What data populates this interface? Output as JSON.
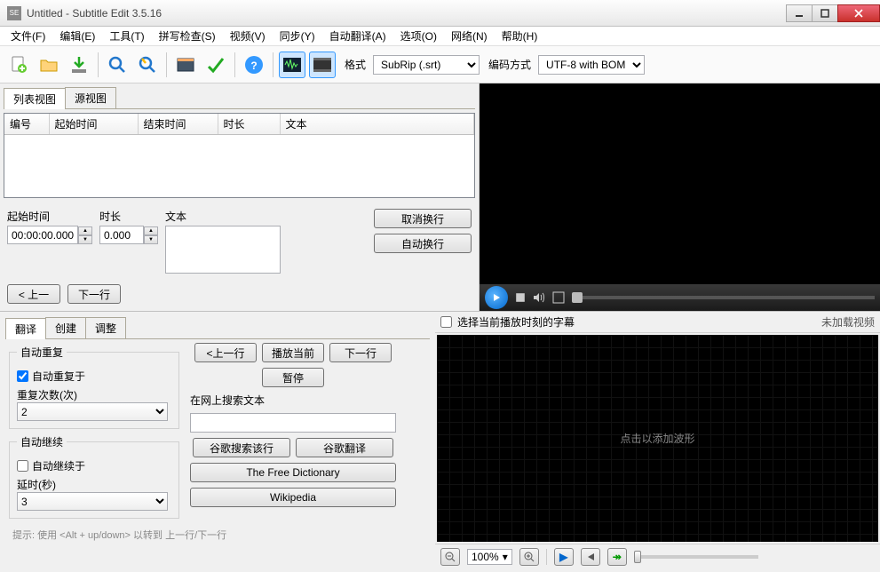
{
  "title": "Untitled - Subtitle Edit 3.5.16",
  "menu": {
    "file": "文件(F)",
    "edit": "编辑(E)",
    "tools": "工具(T)",
    "spell": "拼写检查(S)",
    "video": "视频(V)",
    "sync": "同步(Y)",
    "autotrans": "自动翻译(A)",
    "options": "选项(O)",
    "network": "网络(N)",
    "help": "帮助(H)"
  },
  "toolbar": {
    "format_label": "格式",
    "format_value": "SubRip (.srt)",
    "encoding_label": "编码方式",
    "encoding_value": "UTF-8 with BOM"
  },
  "listArea": {
    "tab_list": "列表视图",
    "tab_source": "源视图",
    "col_no": "编号",
    "col_start": "起始时间",
    "col_end": "结束时间",
    "col_dur": "时长",
    "col_text": "文本"
  },
  "edit": {
    "start_label": "起始时间",
    "start_value": "00:00:00.000",
    "dur_label": "时长",
    "dur_value": "0.000",
    "text_label": "文本",
    "unbreak": "取消换行",
    "autobreak": "自动换行",
    "prev": "< 上一",
    "next": "下一行"
  },
  "bottom": {
    "tab_translate": "翻译",
    "tab_create": "创建",
    "tab_adjust": "调整",
    "auto_repeat_group": "自动重复",
    "auto_repeat_at": "自动重复于",
    "repeat_count_label": "重复次数(次)",
    "repeat_count_value": "2",
    "auto_continue_group": "自动继续",
    "auto_continue_at": "自动继续于",
    "delay_label": "延时(秒)",
    "delay_value": "3",
    "btn_prev": "<上一行",
    "btn_playcur": "播放当前",
    "btn_next": "下一行",
    "btn_pause": "暂停",
    "search_label": "在网上搜索文本",
    "google_search": "谷歌搜索该行",
    "google_translate": "谷歌翻译",
    "free_dict": "The Free Dictionary",
    "wikipedia": "Wikipedia",
    "hint": "提示: 使用 <Alt + up/down> 以转到 上一行/下一行"
  },
  "wave": {
    "select_sub_at_play": "选择当前播放时刻的字幕",
    "no_video": "未加载视频",
    "click_add": "点击以添加波形",
    "zoom": "100%"
  }
}
